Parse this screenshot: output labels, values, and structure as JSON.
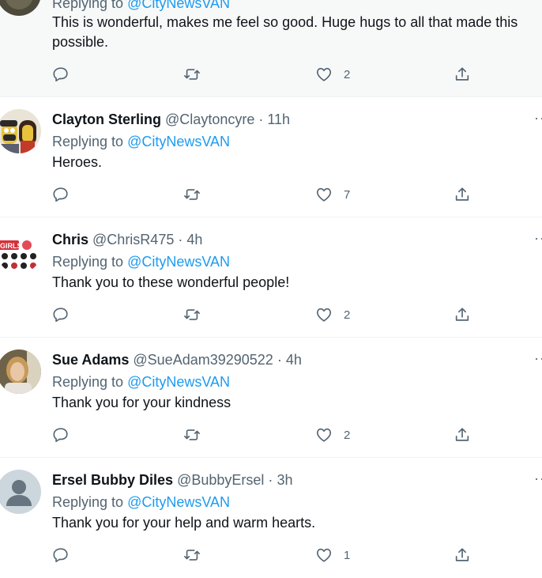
{
  "reply_prefix": "Replying to",
  "tweets": [
    {
      "reply_to": "@CityNewsVAN",
      "text": "This is wonderful, makes me feel so good. Huge hugs to all that made this possible.",
      "likes": "2"
    },
    {
      "name": "Clayton Sterling",
      "handle": "@Claytoncyre",
      "time": "11h",
      "reply_to": "@CityNewsVAN",
      "text": "Heroes.",
      "likes": "7"
    },
    {
      "name": "Chris",
      "handle": "@ChrisR475",
      "time": "4h",
      "reply_to": "@CityNewsVAN",
      "text": "Thank you to these wonderful people!",
      "likes": "2"
    },
    {
      "name": "Sue Adams",
      "handle": "@SueAdam39290522",
      "time": "4h",
      "reply_to": "@CityNewsVAN",
      "text": "Thank you for your kindness",
      "likes": "2"
    },
    {
      "name": "Ersel Bubby Diles",
      "handle": "@BubbyErsel",
      "time": "3h",
      "reply_to": "@CityNewsVAN",
      "text": "Thank you for your help and warm hearts.",
      "likes": "1"
    }
  ],
  "colors": {
    "link": "#1d9bf0",
    "secondary": "#536471",
    "primary": "#0f1419",
    "highlight_bg": "#f7f9f9"
  },
  "icons": [
    "reply-icon",
    "retweet-icon",
    "like-icon",
    "share-icon",
    "more-icon"
  ]
}
